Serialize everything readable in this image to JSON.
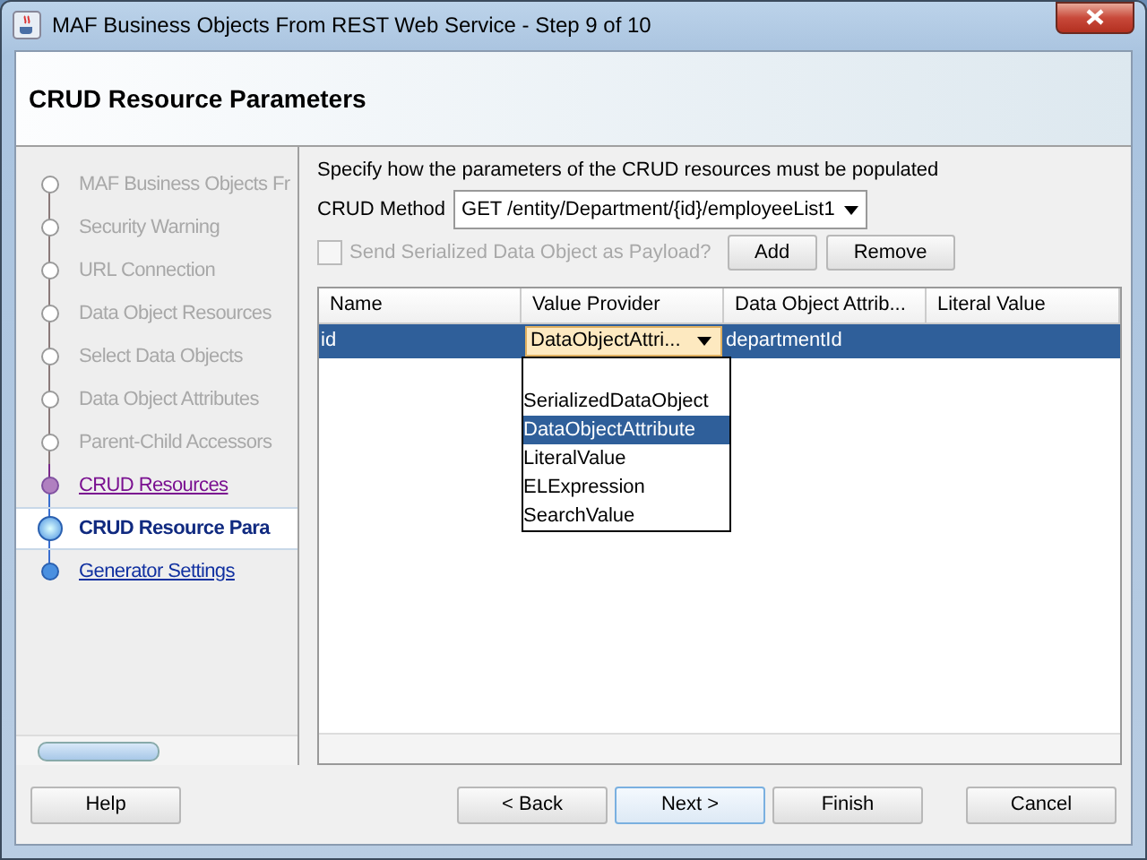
{
  "window": {
    "title": "MAF Business Objects From REST Web Service - Step 9 of 10"
  },
  "header": {
    "title": "CRUD Resource Parameters"
  },
  "steps": [
    {
      "label": "MAF Business Objects Fr",
      "kind": "disabled",
      "selected": false
    },
    {
      "label": "Security Warning",
      "kind": "disabled",
      "selected": false
    },
    {
      "label": "URL Connection",
      "kind": "disabled",
      "selected": false
    },
    {
      "label": "Data Object Resources",
      "kind": "disabled",
      "selected": false
    },
    {
      "label": "Select Data Objects",
      "kind": "disabled",
      "selected": false
    },
    {
      "label": "Data Object Attributes",
      "kind": "disabled",
      "selected": false
    },
    {
      "label": "Parent-Child Accessors",
      "kind": "disabled",
      "selected": false
    },
    {
      "label": "CRUD Resources",
      "kind": "visited",
      "selected": false
    },
    {
      "label": "CRUD Resource Para",
      "kind": "current",
      "selected": true
    },
    {
      "label": "Generator Settings",
      "kind": "link",
      "selected": false
    }
  ],
  "instructions": "Specify how the parameters of the CRUD resources must be populated",
  "crud_method": {
    "label": "CRUD Method",
    "value": "GET /entity/Department/{id}/employeeList1"
  },
  "payload_checkbox": {
    "label": "Send Serialized Data Object as Payload?",
    "checked": false,
    "disabled": true
  },
  "table_buttons": [
    "Add",
    "Remove"
  ],
  "table": {
    "columns": [
      "Name",
      "Value Provider",
      "Data Object Attrib...",
      "Literal Value"
    ],
    "rows": [
      {
        "cells": [
          "id",
          "DataObjectAttri...",
          "departmentId",
          ""
        ],
        "selected": true
      }
    ]
  },
  "provider_dropdown": {
    "options": [
      {
        "label": "SerializedDataObject",
        "selected": false
      },
      {
        "label": "DataObjectAttribute",
        "selected": true
      },
      {
        "label": "LiteralValue",
        "selected": false
      },
      {
        "label": "ELExpression",
        "selected": false
      },
      {
        "label": "SearchValue",
        "selected": false
      }
    ]
  },
  "footer_buttons": [
    {
      "label": "Help",
      "kind": "help",
      "focused": false
    },
    {
      "label": "< Back",
      "kind": "nav",
      "focused": false
    },
    {
      "label": "Next >",
      "kind": "nav",
      "focused": true
    },
    {
      "label": "Finish",
      "kind": "nav",
      "focused": false
    },
    {
      "label": "Cancel",
      "kind": "cancel",
      "focused": false
    }
  ]
}
